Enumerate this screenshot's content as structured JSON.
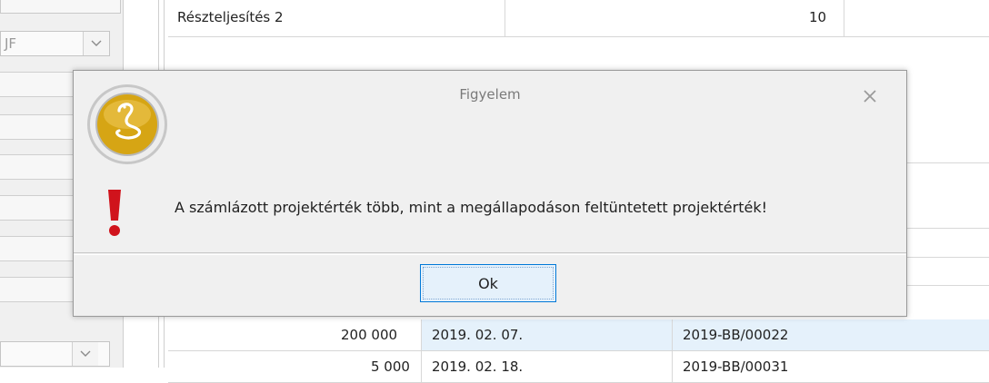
{
  "background": {
    "left_panel": {
      "combo_top_value": "JF"
    },
    "grid_top_row": {
      "name": "Részteljesítés 2",
      "value": "10"
    },
    "rows": [
      {
        "amount": "200 000",
        "date": "2019. 02. 07.",
        "code": "2019-BB/00022"
      },
      {
        "amount": "5 000",
        "date": "2019. 02. 18.",
        "code": "2019-BB/00031"
      }
    ]
  },
  "dialog": {
    "title": "Figyelem",
    "message": "A számlázott projektérték több, mint a megállapodáson feltüntetett projektérték!",
    "ok_label": "Ok",
    "icons": {
      "app_logo": "cobra-logo-icon",
      "warning": "exclamation-icon",
      "close": "close-icon"
    }
  },
  "colors": {
    "dialog_bg": "#f0f0f0",
    "accent": "#0078d7",
    "warning": "#d0131c",
    "logo_gold": "#d6a514",
    "selection": "#e5f1fb"
  }
}
